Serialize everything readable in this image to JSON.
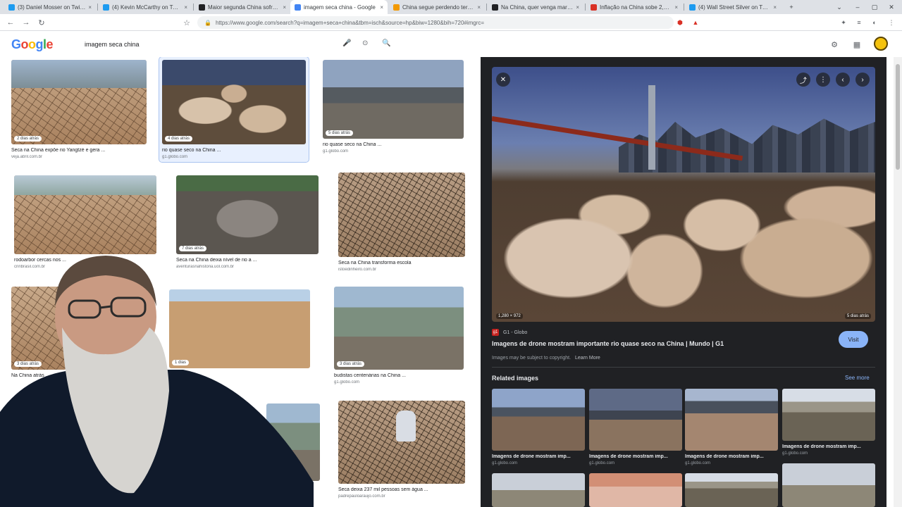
{
  "browser": {
    "tabs": [
      {
        "title": "(3) Daniel Mosser on Twitter: \"U",
        "color": "#1d9bf0"
      },
      {
        "title": "(4) Kevin McCarthy on Twitter:",
        "color": "#1d9bf0"
      },
      {
        "title": "Maior segunda China sofre com",
        "color": "#202124"
      },
      {
        "title": "imagem seca china - Google",
        "color": "#4285f4"
      },
      {
        "title": "China segue perdendo terreno",
        "color": "#f29900"
      },
      {
        "title": "Na China, quer venga marcar",
        "color": "#202124"
      },
      {
        "title": "Inflação na China sobe 2,7% e",
        "color": "#d93025"
      },
      {
        "title": "(4) Wall Street Silver on Twitter",
        "color": "#1d9bf0"
      }
    ],
    "active_tab": 3,
    "url": "https://www.google.com/search?q=imagem+seca+china&tbm=isch&source=hp&biw=1280&bih=720#imgrc=",
    "new_tab": "+",
    "tab_close": "×",
    "nav": {
      "back": "←",
      "forward": "→",
      "reload": "↻",
      "star": "☆",
      "lock": "🔒"
    },
    "window": {
      "minimize": "–",
      "maximize": "▢",
      "close": "✕",
      "chevron": "⌄"
    }
  },
  "google": {
    "logo_letters": [
      {
        "ch": "G",
        "color": "#4285f4"
      },
      {
        "ch": "o",
        "color": "#ea4335"
      },
      {
        "ch": "o",
        "color": "#fbbc05"
      },
      {
        "ch": "g",
        "color": "#4285f4"
      },
      {
        "ch": "l",
        "color": "#34a853"
      },
      {
        "ch": "e",
        "color": "#ea4335"
      }
    ],
    "query": "imagem seca china",
    "mic": "🎤",
    "lens": "⊙",
    "search": "🔍",
    "settings": "⚙",
    "apps": "▦"
  },
  "results": [
    {
      "caption": "Seca na China expõe rio Yangtzé e gera ...",
      "source": "veja.abril.com.br",
      "age": "2 dias atrás"
    },
    {
      "caption": "rio quase seco na China ...",
      "source": "g1.globo.com",
      "age": "4 dias atrás"
    },
    {
      "caption": "rio quase seco na China ...",
      "source": "g1.globo.com",
      "age": "5 dias atrás"
    },
    {
      "caption": "rodoarbor cercas nos ...",
      "source": "cnnbrasil.com.br",
      "age": ""
    },
    {
      "caption": "Seca na China deixa nível de rio a ...",
      "source": "aventurasnahistoria.uol.com.br",
      "age": "7 dias atrás"
    },
    {
      "caption": "Seca na China transforma escola",
      "source": "istoedinheiro.com.br",
      "age": ""
    },
    {
      "caption": "Na China atrás ...",
      "source": "",
      "age": "3 dias atrás"
    },
    {
      "caption": "",
      "source": "",
      "age": "1 dias"
    },
    {
      "caption": "budistas centenárias na China ...",
      "source": "g1.globo.com",
      "age": "3 dias atrás"
    },
    {
      "caption": "Seca deixa 237 mil pessoas sem água ...",
      "source": "padrepauloaraujo.com.br",
      "age": ""
    }
  ],
  "preview": {
    "close": "✕",
    "share": "⤴",
    "more": "⋮",
    "prev": "‹",
    "next": "›",
    "size": "1,280 × 972",
    "age": "5 dias atrás",
    "site": "G1 - Globo",
    "site_icon": "g1",
    "title": "Imagens de drone mostram importante rio quase seco na China | Mundo | G1",
    "visit": "Visit",
    "copyright": "Images may be subject to copyright.",
    "learn_more": "Learn More",
    "related_title": "Related images",
    "see_more": "See more",
    "related": [
      {
        "caption": "Imagens de drone mostram imp...",
        "source": "g1.globo.com"
      },
      {
        "caption": "Imagens de drone mostram imp...",
        "source": "g1.globo.com"
      },
      {
        "caption": "Imagens de drone mostram imp...",
        "source": "g1.globo.com"
      },
      {
        "caption": "Imagens de drone mostram imp...",
        "source": "g1.globo.com"
      }
    ]
  }
}
